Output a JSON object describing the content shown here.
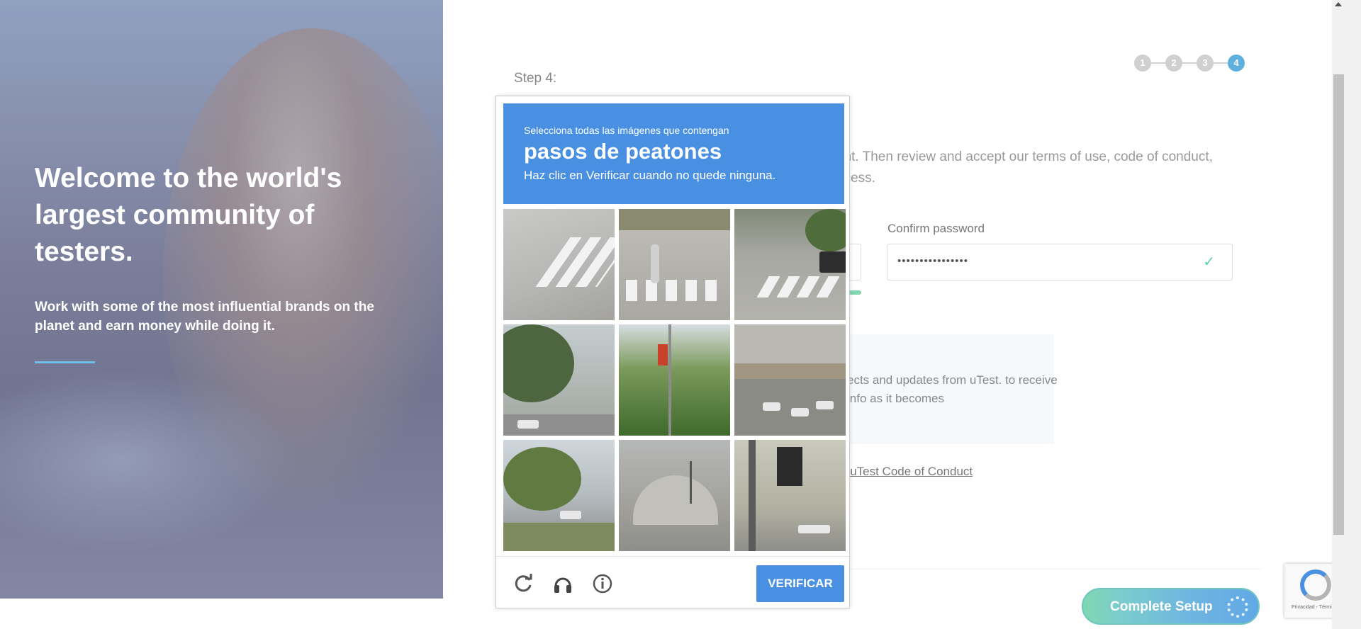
{
  "hero": {
    "title": "Welcome to the world's largest community of testers.",
    "subtitle": "Work with some of the most influential brands on the planet and earn money while doing it."
  },
  "steps": [
    "1",
    "2",
    "3",
    "4"
  ],
  "active_step": 4,
  "form": {
    "step_title": "Step 4:",
    "intro": "unt. Then review and accept our terms of use, code of conduct, ocess.",
    "confirm_password_label": "Confirm password",
    "confirm_password_value": "••••••••••••••••",
    "check_icon": "check-icon",
    "info_text": "ects and updates from uTest. to receive info as it becomes",
    "conduct_prefix": "e ",
    "conduct_link": "uTest Code of Conduct",
    "complete_button": "Complete Setup"
  },
  "captcha": {
    "instruction": "Selecciona todas las imágenes que contengan",
    "target": "pasos de peatones",
    "hint": "Haz clic en Verificar cuando no quede ninguna.",
    "verify_label": "VERIFICAR",
    "icons": [
      "reload-icon",
      "audio-icon",
      "info-icon"
    ],
    "tiles": [
      "crosswalk-road",
      "pedestrian-crosswalk",
      "crosswalk-intersection",
      "trees-traffic-light",
      "traffic-light-tree",
      "overpass-traffic",
      "suburban-street",
      "stadium-dome",
      "traffic-signal-cars"
    ]
  },
  "recaptcha_badge": {
    "terms": "Privacidad - Términos"
  },
  "colors": {
    "captcha_blue": "#4a90e2",
    "accent_green": "#7fd6b0",
    "step_active": "#5fb0de"
  }
}
